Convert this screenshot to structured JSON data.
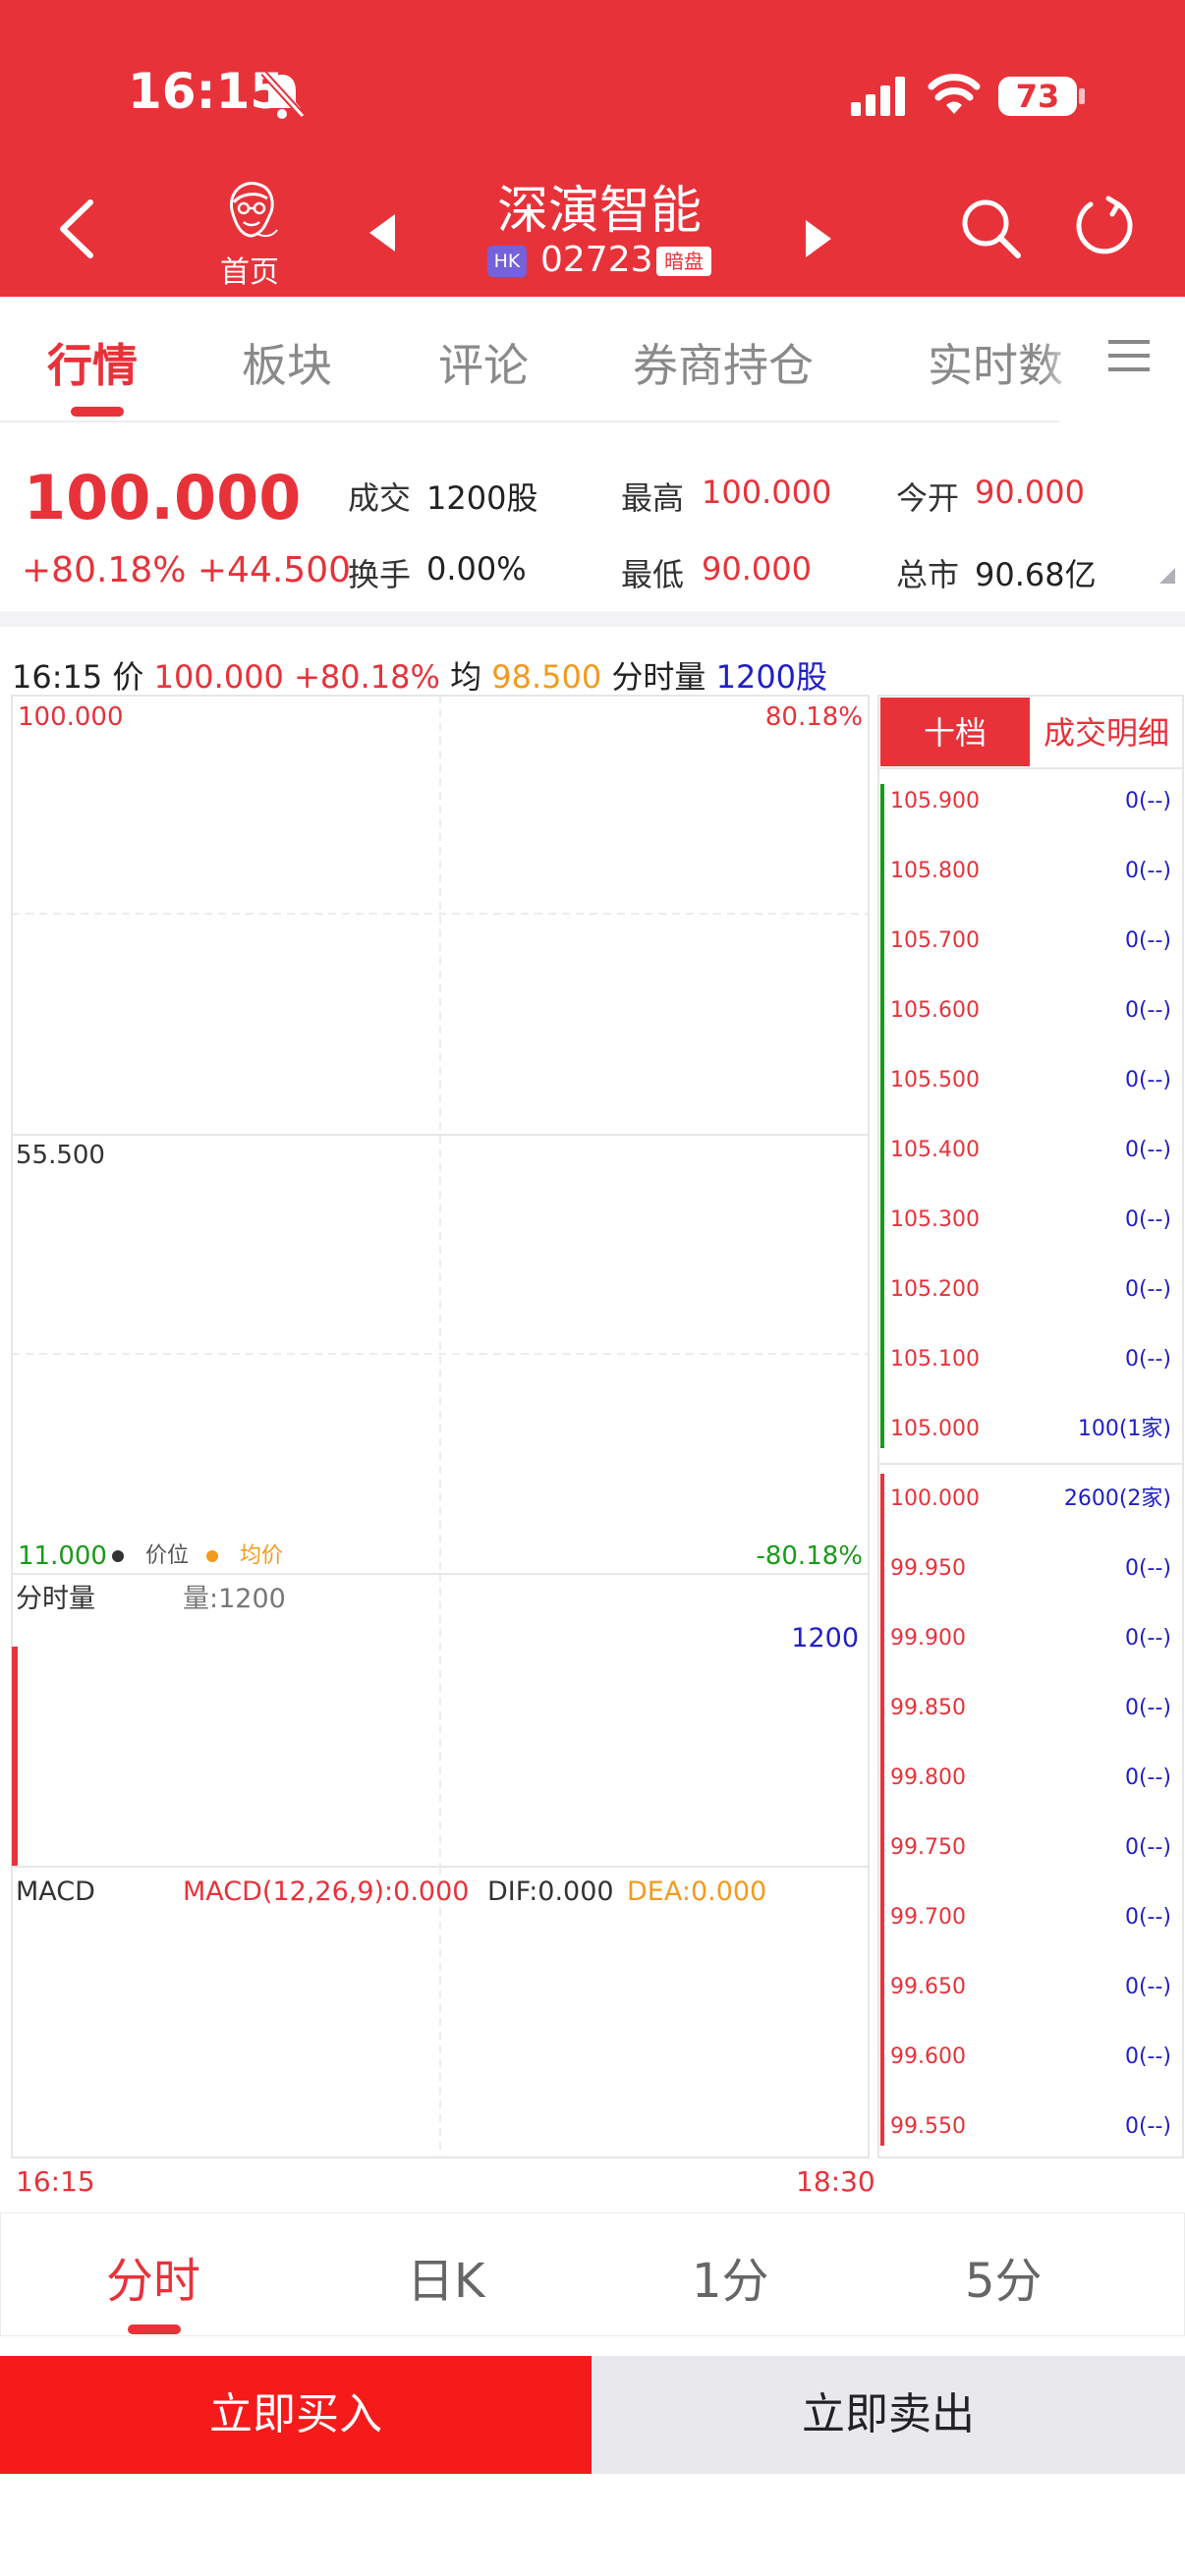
{
  "status": {
    "time": "16:15",
    "battery": "73"
  },
  "nav": {
    "home_label": "首页",
    "stock_name": "深演智能",
    "market_badge": "HK",
    "code": "02723",
    "dark_badge": "暗盘"
  },
  "tabs": [
    "行情",
    "板块",
    "评论",
    "券商持仓",
    "实时数"
  ],
  "quote": {
    "price": "100.000",
    "change": "+80.18% +44.500",
    "volume_label": "成交",
    "volume": "1200股",
    "high_label": "最高",
    "high": "100.000",
    "open_label": "今开",
    "open": "90.000",
    "turnover_label": "换手",
    "turnover": "0.00%",
    "low_label": "最低",
    "low": "90.000",
    "mcap_label": "总市",
    "mcap": "90.68亿"
  },
  "info": {
    "time": "16:15",
    "price_label": "价",
    "price": "100.000",
    "pct": "+80.18%",
    "avg_label": "均",
    "avg": "98.500",
    "vol_label": "分时量",
    "vol": "1200股"
  },
  "chart": {
    "y_top": "100.000",
    "y_mid": "55.500",
    "y_bottom": "11.000",
    "pct_top": "80.18%",
    "pct_bottom": "-80.18%",
    "legend_price": "价位",
    "legend_avg": "均价",
    "vol_title": "分时量",
    "vol_text": "量:1200",
    "vol_max": "1200",
    "macd_title": "MACD",
    "macd_params": "MACD(12,26,9):0.000",
    "dif": "DIF:0.000",
    "dea": "DEA:0.000",
    "time_start": "16:15",
    "time_end": "18:30",
    "colors": {
      "up": "#e8323a",
      "down": "#1a9a1a",
      "avg": "#f39a1e",
      "qty": "#2020c8"
    }
  },
  "book": {
    "tab_depth": "十档",
    "tab_trades": "成交明细",
    "asks": [
      {
        "price": "105.900",
        "qty": "0(--)"
      },
      {
        "price": "105.800",
        "qty": "0(--)"
      },
      {
        "price": "105.700",
        "qty": "0(--)"
      },
      {
        "price": "105.600",
        "qty": "0(--)"
      },
      {
        "price": "105.500",
        "qty": "0(--)"
      },
      {
        "price": "105.400",
        "qty": "0(--)"
      },
      {
        "price": "105.300",
        "qty": "0(--)"
      },
      {
        "price": "105.200",
        "qty": "0(--)"
      },
      {
        "price": "105.100",
        "qty": "0(--)"
      },
      {
        "price": "105.000",
        "qty": "100(1家)"
      }
    ],
    "bids": [
      {
        "price": "100.000",
        "qty": "2600(2家)"
      },
      {
        "price": "99.950",
        "qty": "0(--)"
      },
      {
        "price": "99.900",
        "qty": "0(--)"
      },
      {
        "price": "99.850",
        "qty": "0(--)"
      },
      {
        "price": "99.800",
        "qty": "0(--)"
      },
      {
        "price": "99.750",
        "qty": "0(--)"
      },
      {
        "price": "99.700",
        "qty": "0(--)"
      },
      {
        "price": "99.650",
        "qty": "0(--)"
      },
      {
        "price": "99.600",
        "qty": "0(--)"
      },
      {
        "price": "99.550",
        "qty": "0(--)"
      }
    ]
  },
  "periods": [
    "分时",
    "日K",
    "1分",
    "5分"
  ],
  "actions": {
    "buy": "立即买入",
    "sell": "立即卖出"
  }
}
